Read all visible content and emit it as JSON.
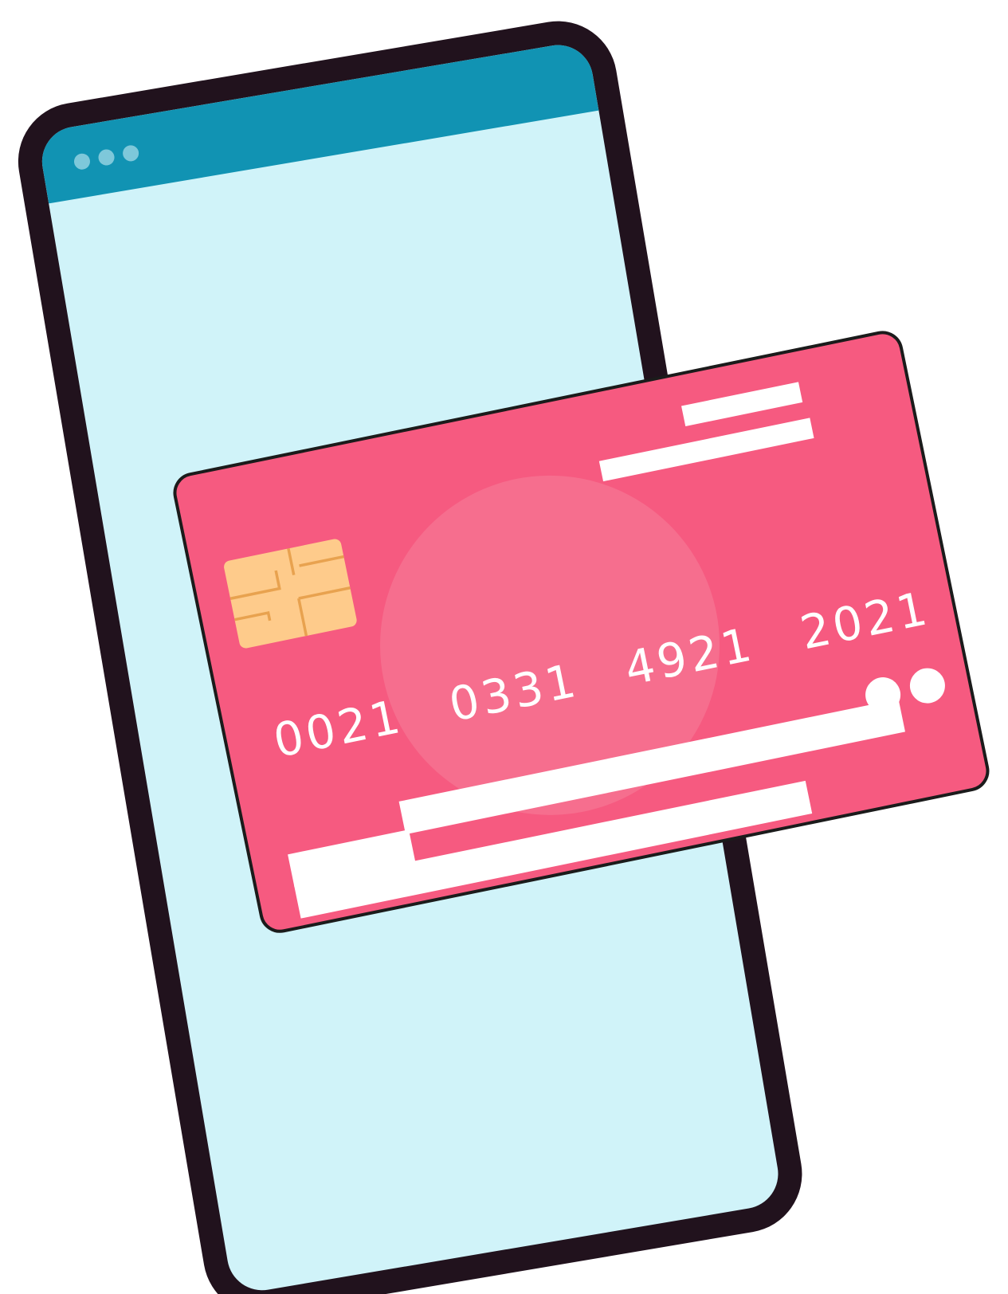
{
  "phone": {
    "frame_color": "#21121d",
    "header_color": "#1193b3",
    "screen_color": "#d0f3f9",
    "header_dot_color": "#7ec8da",
    "header_icon": "three-dots-icon"
  },
  "card": {
    "color": "#f65a80",
    "highlight_color": "#f66e8e",
    "stripe_color": "#ffffff",
    "chip_color": "#fecb8b",
    "chip_line_color": "#e8a24f",
    "number_groups": [
      "0021",
      "0331",
      "4921",
      "2021"
    ],
    "logo_icon": "two-circles-icon"
  }
}
